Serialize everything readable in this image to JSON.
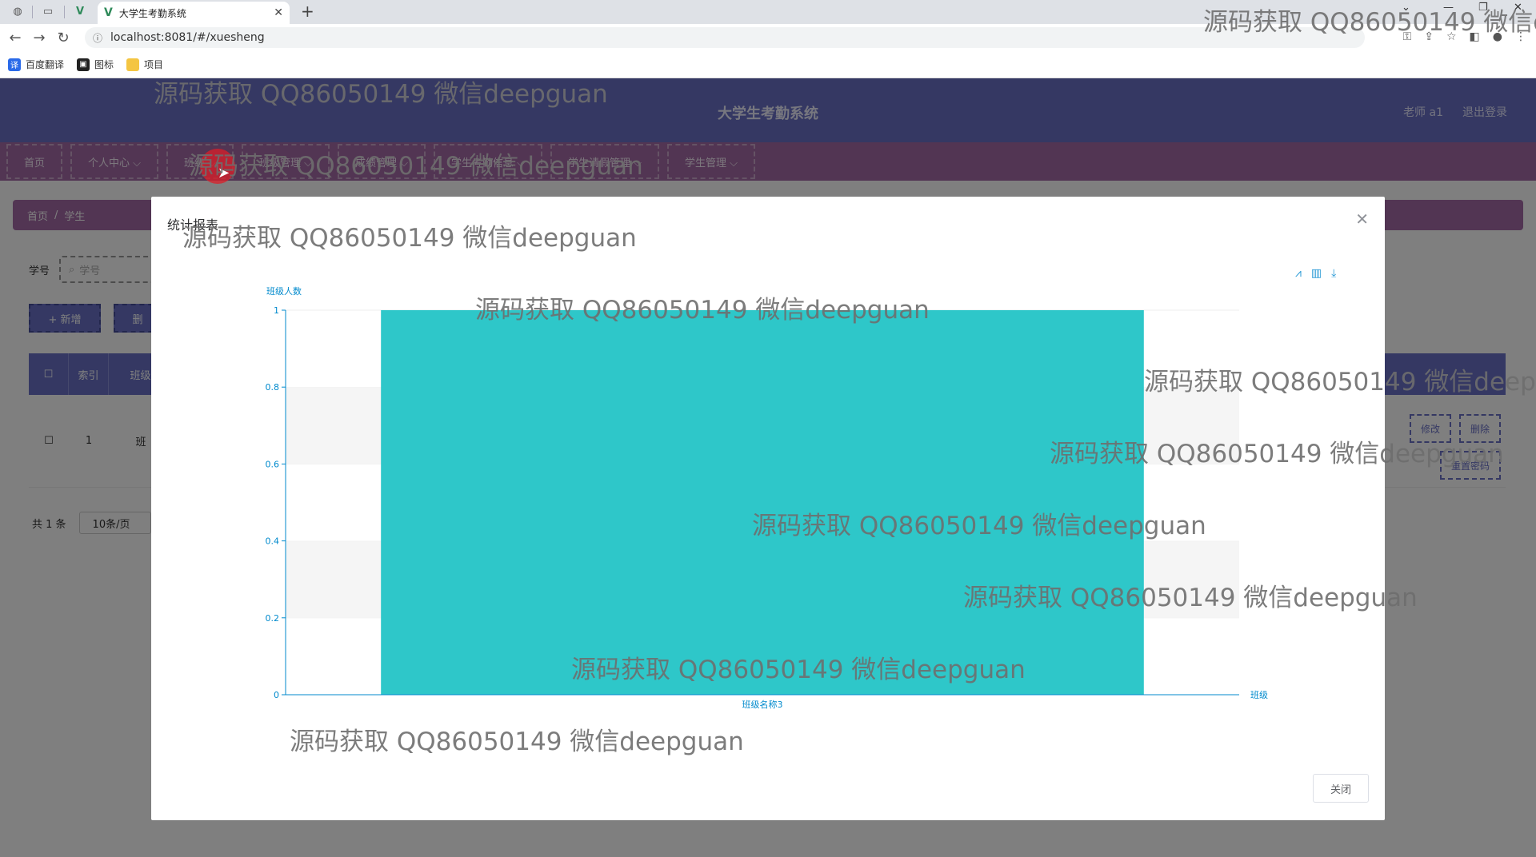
{
  "browser": {
    "tab_title": "大学生考勤系统",
    "tab_logo": "V",
    "url": "localhost:8081/#/xuesheng",
    "bookmarks": [
      {
        "label": "百度翻译",
        "color": "#2a6ae9",
        "icon": "译"
      },
      {
        "label": "图标",
        "color": "#222222",
        "icon": "▣"
      },
      {
        "label": "项目",
        "color": "#f4c542",
        "icon": ""
      }
    ]
  },
  "app": {
    "title": "大学生考勤系统",
    "user": "老师 a1",
    "logout": "退出登录",
    "menu": [
      "首页",
      "个人中心 ⌵",
      "班级 ⌵",
      "班级管理 ⌵",
      "成绩管理 ⌵",
      "学生考勤信息 ⌵",
      "学生请假管理 ⌵",
      "学生管理 ⌵"
    ],
    "breadcrumb": {
      "home": "首页",
      "sep": "/",
      "current": "学生"
    },
    "search_label": "学号",
    "search_placeholder": "学号",
    "add_button": "+ 新增",
    "delete_button": "删",
    "table_headers": [
      "",
      "索引",
      "班级"
    ],
    "row": {
      "index": "1",
      "class_prefix": "班"
    },
    "row_actions": {
      "edit": "修改",
      "delete": "删除",
      "reset": "重置密码"
    },
    "pager": {
      "total": "共 1 条",
      "size": "10条/页"
    }
  },
  "dialog": {
    "title": "统计报表",
    "close_button": "关闭",
    "chart_data": {
      "type": "bar",
      "categories": [
        "班级名称3"
      ],
      "values": [
        1
      ],
      "xlabel": "班级",
      "ylabel": "班级人数",
      "ylim": [
        0,
        1
      ],
      "yticks": [
        "0",
        "0.2",
        "0.4",
        "0.6",
        "0.8",
        "1"
      ],
      "bar_color": "#2ec7c9",
      "axis_color": "#008acd"
    }
  },
  "watermark": "源码获取 QQ86050149 微信deepguan"
}
